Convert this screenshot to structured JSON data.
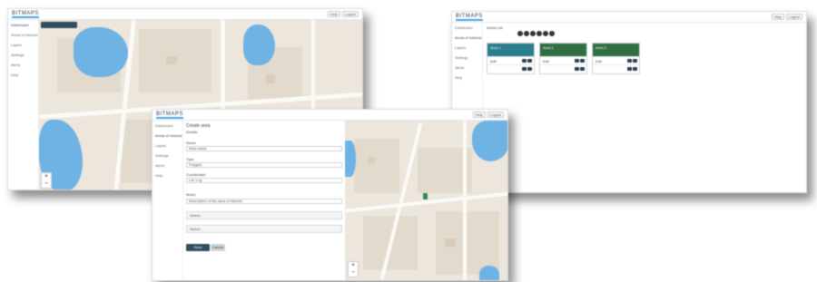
{
  "app": {
    "brand": "BITMAPS"
  },
  "topbar": {
    "btn_a": "Help",
    "btn_b": "Logout"
  },
  "sidebar": {
    "items": [
      "Dashboard",
      "Areas of Interest",
      "Layers",
      "Settings",
      "Alerts",
      "Help"
    ]
  },
  "map": {
    "zoom_in": "+",
    "zoom_out": "−"
  },
  "cards_view": {
    "tab_label": "Areas List",
    "cards": [
      {
        "title": "Area 1",
        "color": "#2a7d8c",
        "row": "Edit"
      },
      {
        "title": "Area 2",
        "color": "#2f6f43",
        "row": "Edit"
      },
      {
        "title": "Area 3",
        "color": "#2f6f43",
        "row": "Edit"
      }
    ]
  },
  "form_view": {
    "title": "Create area",
    "subtitle": "Details",
    "name_label": "Name",
    "name_value": "Area name",
    "type_label": "Type",
    "type_value": "Polygon",
    "coords_label": "Coordinates",
    "coords_value": "Lat, Lng",
    "notes_label": "Notes",
    "notes_value": "Description of the area of interest",
    "select_1": "Select...",
    "select_2": "Select...",
    "save": "Save",
    "cancel": "Cancel"
  },
  "colors": {
    "water": "#6fb2e4",
    "map_bg": "#ece6dc",
    "primary": "#2f4f5f",
    "accent": "#4aa3df"
  }
}
